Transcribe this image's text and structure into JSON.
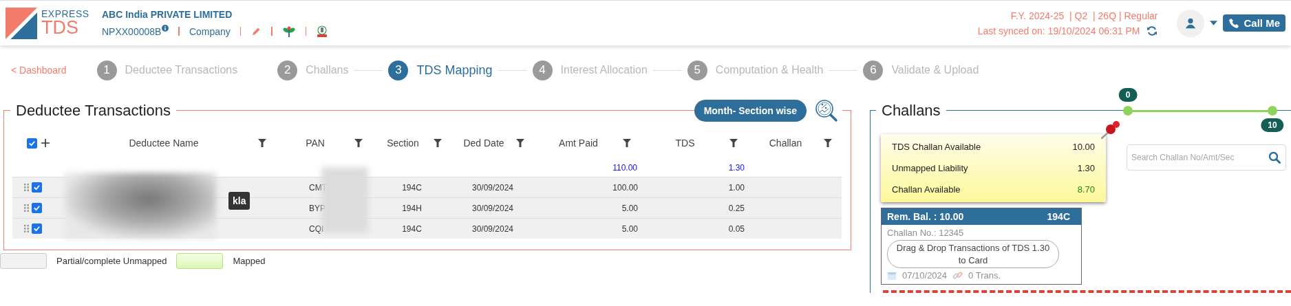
{
  "header": {
    "logo": {
      "top_word": "EXPRESS",
      "bottom_word": "TDS"
    },
    "company_name": "ABC India PRIVATE LIMITED",
    "pan": "NPXX00008B",
    "entity_type": "Company",
    "return_info": "F.Y. 2024-25  | Q2  | 26Q | Regular",
    "last_synced": "Last synced on: 19/10/2024 06:31 PM",
    "call_button": "Call Me"
  },
  "nav": {
    "back_link": "< Dashboard",
    "steps": [
      {
        "number": "1",
        "label": "Deductee Transactions",
        "selected": false
      },
      {
        "number": "2",
        "label": "Challans",
        "selected": false
      },
      {
        "number": "3",
        "label": "TDS Mapping",
        "selected": true
      },
      {
        "number": "4",
        "label": "Interest Allocation",
        "selected": false
      },
      {
        "number": "5",
        "label": "Computation & Health",
        "selected": false
      },
      {
        "number": "6",
        "label": "Validate & Upload",
        "selected": false
      }
    ]
  },
  "deductee_panel": {
    "title": "Deductee Transactions",
    "view_button": "Month- Section wise",
    "table": {
      "select_all_checked": true,
      "columns": [
        "Deductee Name",
        "PAN",
        "Section",
        "Ded Date",
        "Amt Paid",
        "TDS",
        "Challan"
      ],
      "totals": {
        "amt_paid": "110.00",
        "tds": "1.30"
      },
      "rows": [
        {
          "checked": true,
          "pan": "CMT",
          "section": "194C",
          "ded_date": "30/09/2024",
          "amt_paid": "100.00",
          "tds": "1.00"
        },
        {
          "checked": true,
          "pan": "BYP",
          "section": "194H",
          "ded_date": "30/09/2024",
          "amt_paid": "5.00",
          "tds": "0.25"
        },
        {
          "checked": true,
          "pan": "CQI",
          "section": "194C",
          "ded_date": "30/09/2024",
          "amt_paid": "5.00",
          "tds": "0.05"
        }
      ],
      "tooltip": "kla"
    },
    "legend": [
      {
        "kind": "unmapped",
        "label": "Partial/complete Unmapped"
      },
      {
        "kind": "mapped",
        "label": "Mapped"
      }
    ]
  },
  "challans_panel": {
    "title": "Challans",
    "range": {
      "thumbs": [
        {
          "label": "0",
          "level": 0
        },
        {
          "label": "10",
          "level": 1
        }
      ]
    },
    "summary": [
      {
        "kind": "amount",
        "label": "TDS Challan Available",
        "value": "10.00"
      },
      {
        "kind": "amount",
        "label": "Unmapped Liability",
        "value": "1.30"
      },
      {
        "kind": "balance",
        "label": "Challan Available",
        "value": "8.70"
      }
    ],
    "search": {
      "placeholder": "Search Challan No/Amt/Sec"
    },
    "cards": [
      {
        "balance": "Rem. Bal. : 10.00",
        "section": "194C",
        "challan_no": "Challan No.: 12345",
        "date": "07/10/2024",
        "transactions": "0 Trans."
      }
    ],
    "drop_hint": "Drag & Drop Transactions of TDS 1.30 to Card"
  }
}
